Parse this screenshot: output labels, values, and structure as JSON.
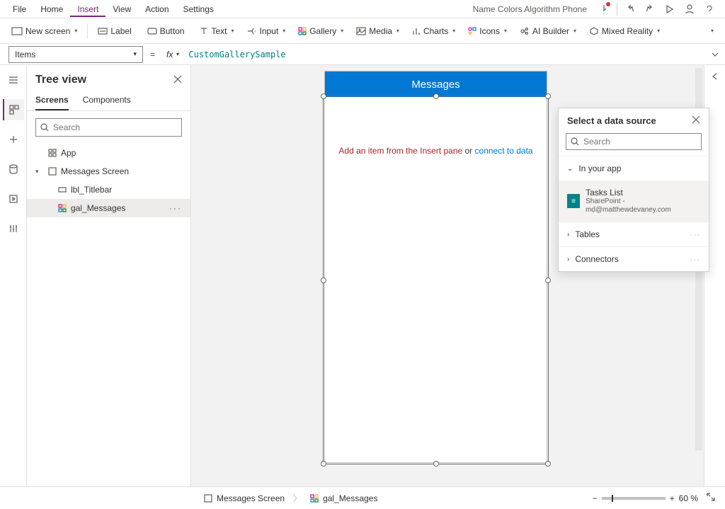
{
  "menu": {
    "items": [
      "File",
      "Home",
      "Insert",
      "View",
      "Action",
      "Settings"
    ],
    "active_index": 2,
    "app_title": "Name Colors Algorithm Phone"
  },
  "ribbon": {
    "new_screen": "New screen",
    "label": "Label",
    "button": "Button",
    "text": "Text",
    "input": "Input",
    "gallery": "Gallery",
    "media": "Media",
    "charts": "Charts",
    "icons": "Icons",
    "ai_builder": "AI Builder",
    "mixed_reality": "Mixed Reality"
  },
  "formula": {
    "property": "Items",
    "value": "CustomGallerySample"
  },
  "tree": {
    "title": "Tree view",
    "tabs": [
      "Screens",
      "Components"
    ],
    "active_tab_index": 0,
    "search_placeholder": "Search",
    "app_label": "App",
    "screen": "Messages Screen",
    "children": [
      {
        "name": "lbl_Titlebar"
      },
      {
        "name": "gal_Messages"
      }
    ],
    "selected": "gal_Messages"
  },
  "canvas": {
    "titlebar_text": "Messages",
    "placeholder_a": "Add an item from the Insert pane",
    "placeholder_or": " or ",
    "placeholder_b": "connect to data"
  },
  "datasource": {
    "title": "Select a data source",
    "search_placeholder": "Search",
    "sections": {
      "in_your_app": "In your app",
      "tables": "Tables",
      "connectors": "Connectors"
    },
    "item": {
      "name": "Tasks List",
      "sub": "SharePoint - md@matthewdevaney.com"
    }
  },
  "status": {
    "crumb1": "Messages Screen",
    "crumb2": "gal_Messages",
    "zoom": "60 %"
  }
}
